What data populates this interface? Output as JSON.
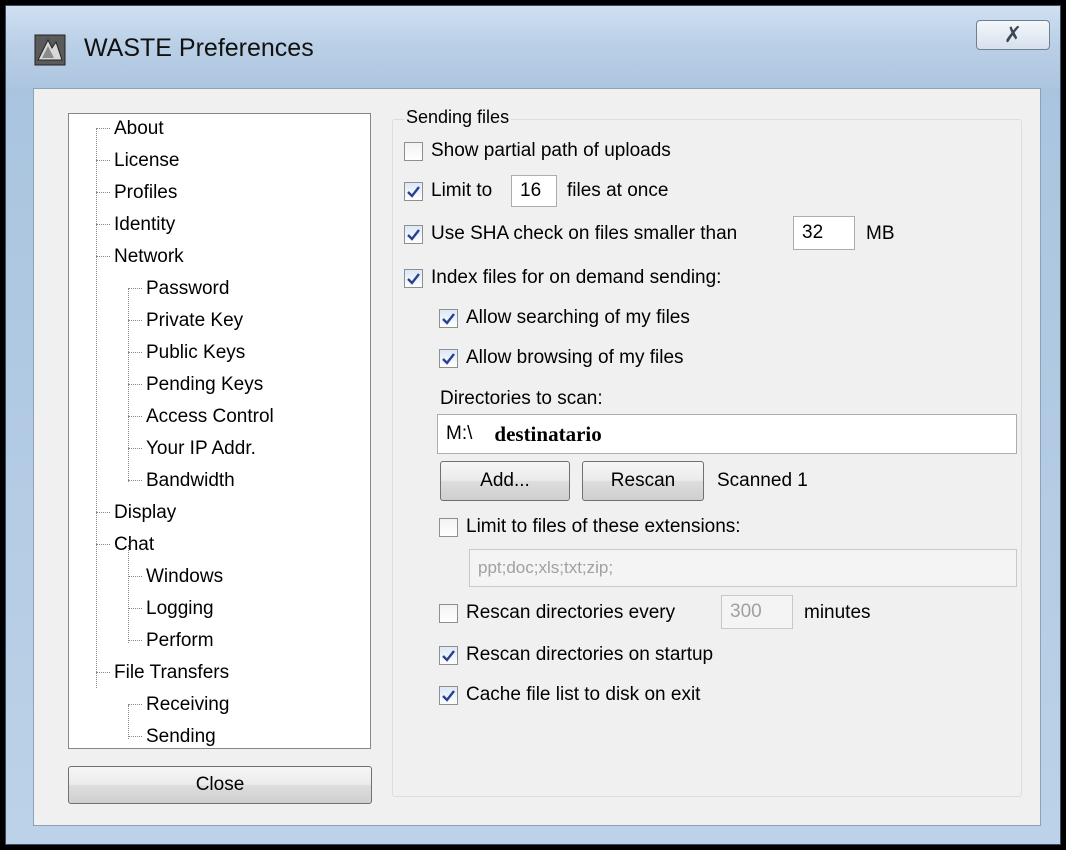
{
  "window": {
    "title": "WASTE Preferences",
    "close_glyph": "✗"
  },
  "tree": {
    "items": [
      {
        "label": "About"
      },
      {
        "label": "License"
      },
      {
        "label": "Profiles"
      },
      {
        "label": "Identity"
      },
      {
        "label": "Network"
      },
      {
        "label": "Password"
      },
      {
        "label": "Private Key"
      },
      {
        "label": "Public Keys"
      },
      {
        "label": "Pending Keys"
      },
      {
        "label": "Access Control"
      },
      {
        "label": "Your IP Addr."
      },
      {
        "label": "Bandwidth"
      },
      {
        "label": "Display"
      },
      {
        "label": "Chat"
      },
      {
        "label": "Windows"
      },
      {
        "label": "Logging"
      },
      {
        "label": "Perform"
      },
      {
        "label": "File Transfers"
      },
      {
        "label": "Receiving"
      },
      {
        "label": "Sending"
      }
    ]
  },
  "close_button": "Close",
  "sending": {
    "group_title": "Sending files",
    "show_partial": {
      "label": "Show partial path of uploads",
      "checked": false
    },
    "limit": {
      "label_before": "Limit to",
      "value": "16",
      "label_after": "files at once",
      "checked": true
    },
    "sha": {
      "label_before": "Use SHA check on files smaller than",
      "value": "32",
      "label_after": "MB",
      "checked": true
    },
    "index": {
      "label": "Index files for on demand sending:",
      "checked": true
    },
    "allow_search": {
      "label": "Allow searching of my files",
      "checked": true
    },
    "allow_browse": {
      "label": "Allow browsing of my files",
      "checked": true
    },
    "dirs_label": "Directories to scan:",
    "dir_prefix": "M:\\",
    "dir_value": "destinatario",
    "add_button": "Add...",
    "rescan_button": "Rescan",
    "scanned_status": "Scanned 1",
    "limit_ext": {
      "label": "Limit to files of these extensions:",
      "checked": false,
      "value": "ppt;doc;xls;txt;zip;"
    },
    "rescan_every": {
      "label_before": "Rescan directories every",
      "value": "300",
      "label_after": "minutes",
      "checked": false
    },
    "rescan_startup": {
      "label": "Rescan directories on startup",
      "checked": true
    },
    "cache_list": {
      "label": "Cache file list to disk on exit",
      "checked": true
    }
  }
}
